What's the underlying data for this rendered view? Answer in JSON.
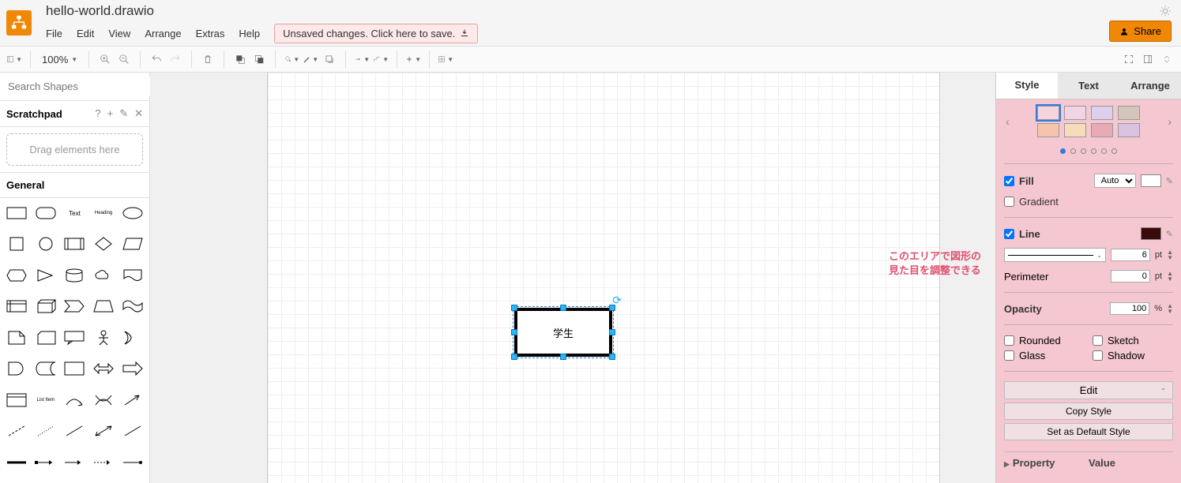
{
  "title": "hello-world.drawio",
  "menu": {
    "file": "File",
    "edit": "Edit",
    "view": "View",
    "arrange": "Arrange",
    "extras": "Extras",
    "help": "Help"
  },
  "save_warning": "Unsaved changes. Click here to save.",
  "share": "Share",
  "zoom": "100%",
  "search_placeholder": "Search Shapes",
  "scratchpad": "Scratchpad",
  "drag_hint": "Drag elements here",
  "general": "General",
  "shape_text": "Text",
  "shape_heading": "Heading",
  "shape_list": "List Item",
  "selected_label": "学生",
  "annotation_l1": "このエリアで図形の",
  "annotation_l2": "見た目を調整できる",
  "tabs": {
    "style": "Style",
    "text": "Text",
    "arrange": "Arrange"
  },
  "panel": {
    "fill": "Fill",
    "fill_mode": "Auto",
    "gradient": "Gradient",
    "line": "Line",
    "line_pt": "6",
    "perimeter": "Perimeter",
    "perimeter_pt": "0",
    "opacity": "Opacity",
    "opacity_val": "100",
    "rounded": "Rounded",
    "sketch": "Sketch",
    "glass": "Glass",
    "shadow": "Shadow",
    "edit": "Edit",
    "copy_style": "Copy Style",
    "default": "Set as Default Style",
    "property": "Property",
    "value": "Value",
    "pt": "pt",
    "pct": "%"
  },
  "swatches_top": [
    "#f6d4de",
    "#f2d4e4",
    "#dcd0ec",
    "#d4c6b8"
  ],
  "swatches_bot": [
    "#f4c4ac",
    "#f6dcb8",
    "#e8aab4",
    "#d8c2e0"
  ]
}
